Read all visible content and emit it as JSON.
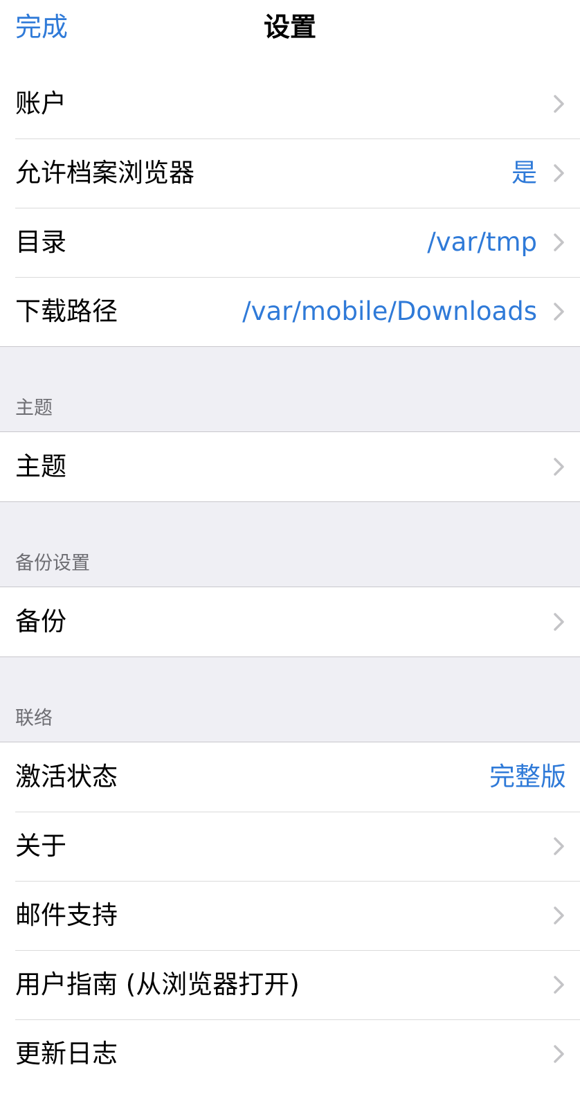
{
  "navbar": {
    "done_label": "完成",
    "title": "设置"
  },
  "general": {
    "rows": [
      {
        "label": "账户",
        "value": ""
      },
      {
        "label": "允许档案浏览器",
        "value": "是"
      },
      {
        "label": "目录",
        "value": "/var/tmp"
      },
      {
        "label": "下载路径",
        "value": "/var/mobile/Downloads"
      }
    ]
  },
  "theme_section": {
    "header": "主题",
    "rows": [
      {
        "label": "主题"
      }
    ]
  },
  "backup_section": {
    "header": "备份设置",
    "rows": [
      {
        "label": "备份"
      }
    ]
  },
  "contact_section": {
    "header": "联络",
    "rows": [
      {
        "label": "激活状态",
        "value": "完整版"
      },
      {
        "label": "关于"
      },
      {
        "label": "邮件支持"
      },
      {
        "label": "用户指南 (从浏览器打开)"
      },
      {
        "label": "更新日志"
      }
    ]
  },
  "colors": {
    "accent": "#2f7ad8",
    "background": "#efeff4",
    "chevron": "#c4c4c7",
    "section_header": "#6d6d72"
  },
  "icons": {
    "chevron": "chevron-right-icon"
  }
}
